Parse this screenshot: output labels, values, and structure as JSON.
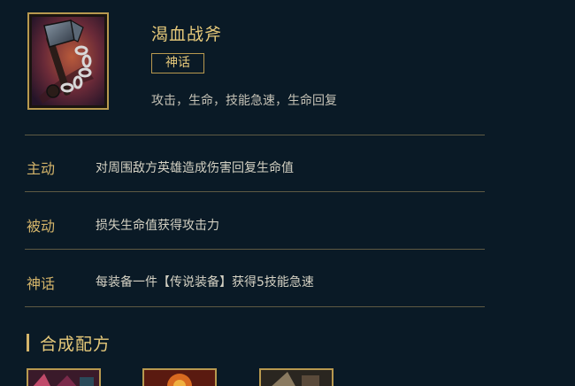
{
  "item": {
    "name": "渴血战斧",
    "icon": "axe-chain-icon",
    "badge": "神话",
    "tags": "攻击，生命，技能急速，生命回复"
  },
  "effects": [
    {
      "label": "主动",
      "text": "对周围敌方英雄造成伤害回复生命值"
    },
    {
      "label": "被动",
      "text": "损失生命值获得攻击力"
    },
    {
      "label": "神话",
      "text": "每装备一件【传说装备】获得5技能急速"
    }
  ],
  "recipe": {
    "title": "合成配方",
    "components": [
      {
        "icon": "component-item-1-icon"
      },
      {
        "icon": "component-item-2-icon"
      },
      {
        "icon": "component-item-3-icon"
      }
    ]
  },
  "colors": {
    "background": "#0a1a26",
    "gold": "#d4b46a",
    "border": "#b8994f"
  }
}
